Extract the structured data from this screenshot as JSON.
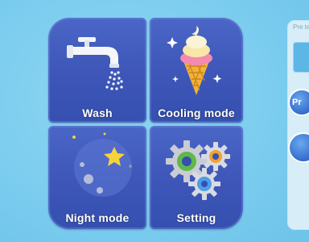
{
  "tiles": {
    "wash": {
      "label": "Wash",
      "icon": "faucet-icon"
    },
    "cooling": {
      "label": "Cooling mode",
      "icon": "ice-cream-icon"
    },
    "night": {
      "label": "Night mode",
      "icon": "moon-icon"
    },
    "setting": {
      "label": "Setting",
      "icon": "gears-icon"
    }
  },
  "side_panel": {
    "caption": "Pre ten",
    "preset_button_label": "Pr"
  },
  "colors": {
    "background": "#7ccdef",
    "tile": "#3d56b8",
    "panel": "#d7eef8",
    "button": "#3a74d2"
  }
}
